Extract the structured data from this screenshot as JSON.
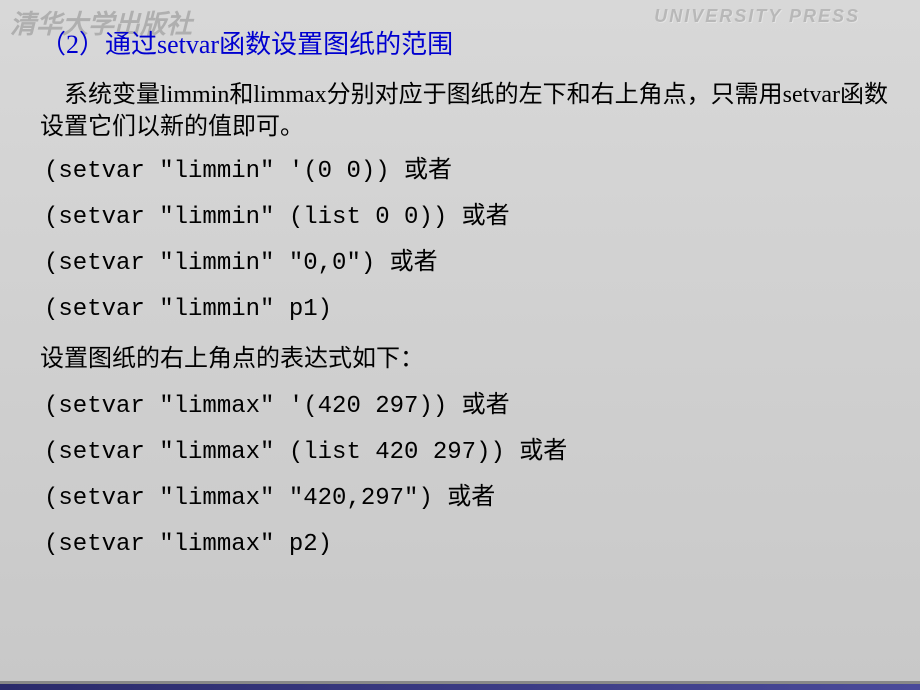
{
  "logo": "清华大学出版社",
  "watermark": "UNIVERSITY PRESS",
  "heading": "（2）通过setvar函数设置图纸的范围",
  "intro": "　系统变量limmin和limmax分别对应于图纸的左下和右上角点，只需用setvar函数设置它们以新的值即可。",
  "limmin_lines": [
    "(setvar \"limmin\" '(0 0)) 或者",
    "(setvar \"limmin\" (list 0 0)) 或者",
    "(setvar \"limmin\" \"0,0\") 或者",
    "(setvar \"limmin\" p1)"
  ],
  "subheading": "设置图纸的右上角点的表达式如下：",
  "limmax_lines": [
    "(setvar \"limmax\" '(420 297)) 或者",
    "(setvar \"limmax\" (list 420 297)) 或者",
    "(setvar \"limmax\" \"420,297\") 或者",
    "(setvar \"limmax\" p2)"
  ]
}
